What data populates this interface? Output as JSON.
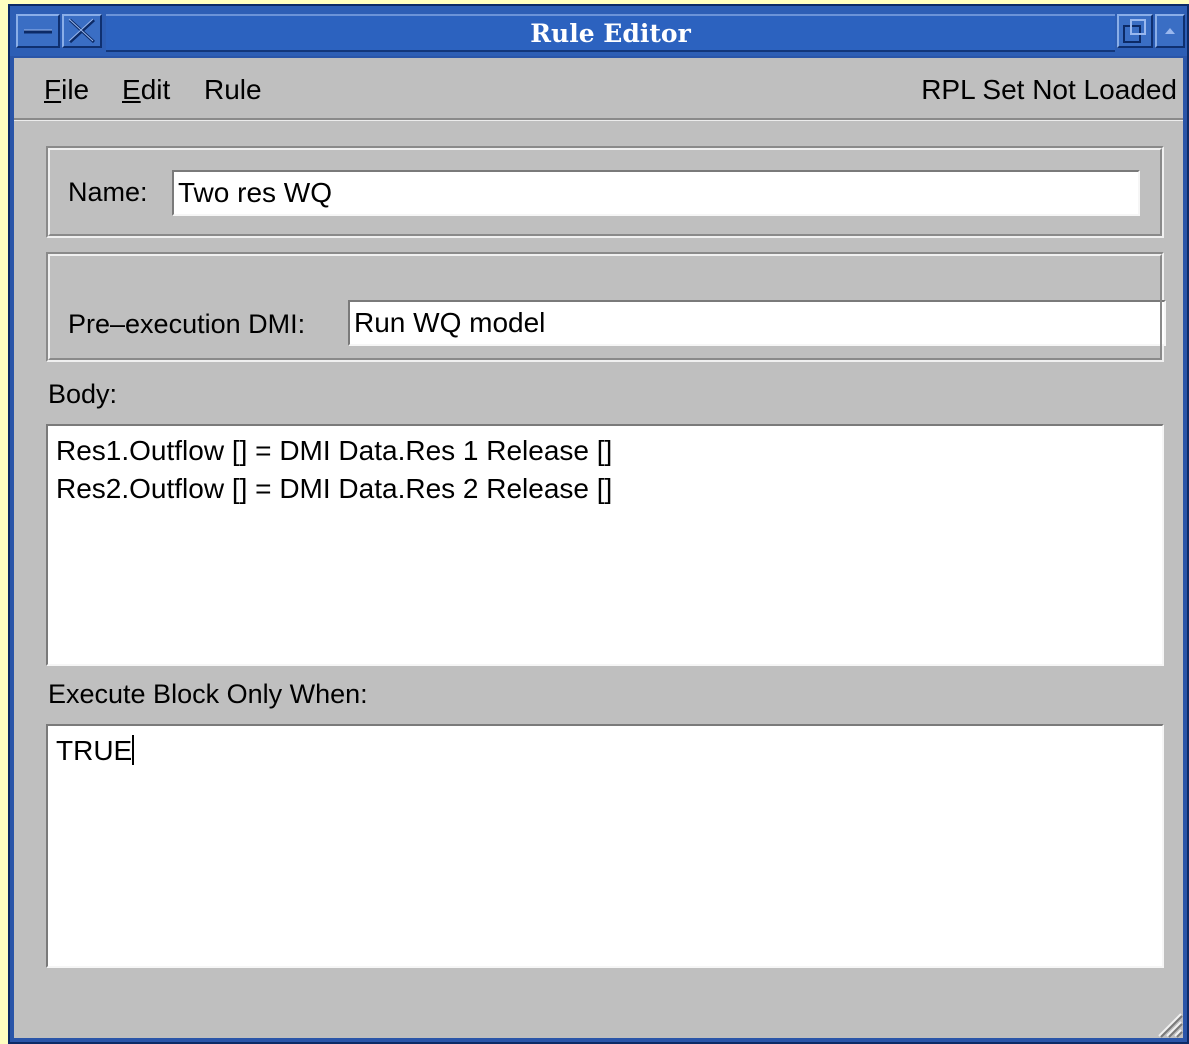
{
  "window": {
    "title": "Rule Editor"
  },
  "menu": {
    "items": [
      {
        "first": "F",
        "rest": "ile"
      },
      {
        "first": "E",
        "rest": "dit"
      },
      {
        "first": "",
        "rest": "Rule"
      }
    ],
    "status": "RPL Set Not Loaded"
  },
  "name": {
    "label": "Name:",
    "value": "Two res WQ"
  },
  "pre_dmi": {
    "label": "Pre–execution DMI:",
    "value": "Run WQ model"
  },
  "body": {
    "label": "Body:",
    "lines": [
      "Res1.Outflow [] = DMI Data.Res 1 Release []",
      "Res2.Outflow [] = DMI Data.Res 2 Release []"
    ]
  },
  "execute": {
    "label": "Execute Block Only When:",
    "text": "TRUE"
  },
  "icons": {
    "minimize": "minimize-icon",
    "close": "close-icon",
    "maximize": "maximize-icon",
    "shade": "shade-icon",
    "resize": "resize-grip-icon"
  }
}
